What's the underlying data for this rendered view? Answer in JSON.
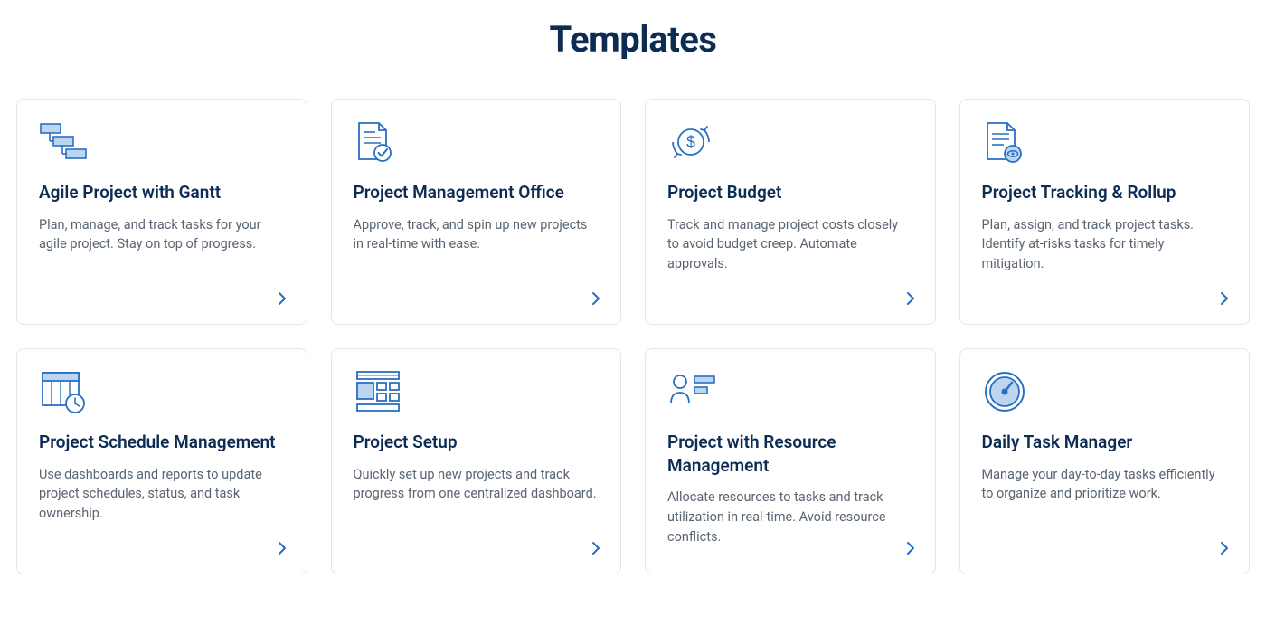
{
  "heading": "Templates",
  "cards": [
    {
      "icon": "gantt-icon",
      "title": "Agile Project with Gantt",
      "desc": "Plan, manage, and track tasks for your agile project. Stay on top of progress."
    },
    {
      "icon": "document-check-icon",
      "title": "Project Management Office",
      "desc": "Approve, track, and spin up new projects in real-time with ease."
    },
    {
      "icon": "budget-icon",
      "title": "Project Budget",
      "desc": "Track and manage project costs closely to avoid budget creep. Automate approvals."
    },
    {
      "icon": "document-eye-icon",
      "title": "Project Tracking & Rollup",
      "desc": "Plan, assign, and track project tasks. Identify at-risks tasks for timely mitigation."
    },
    {
      "icon": "calendar-clock-icon",
      "title": "Project Schedule Management",
      "desc": "Use dashboards and reports to update project schedules, status, and task ownership."
    },
    {
      "icon": "layout-icon",
      "title": "Project Setup",
      "desc": "Quickly set up new projects and track progress from one centralized dashboard."
    },
    {
      "icon": "person-resource-icon",
      "title": "Project with Resource Management",
      "desc": "Allocate resources to tasks and track utilization in real-time. Avoid resource conflicts."
    },
    {
      "icon": "gauge-icon",
      "title": "Daily Task Manager",
      "desc": "Manage your day-to-day tasks efficiently to organize and prioritize work."
    }
  ]
}
